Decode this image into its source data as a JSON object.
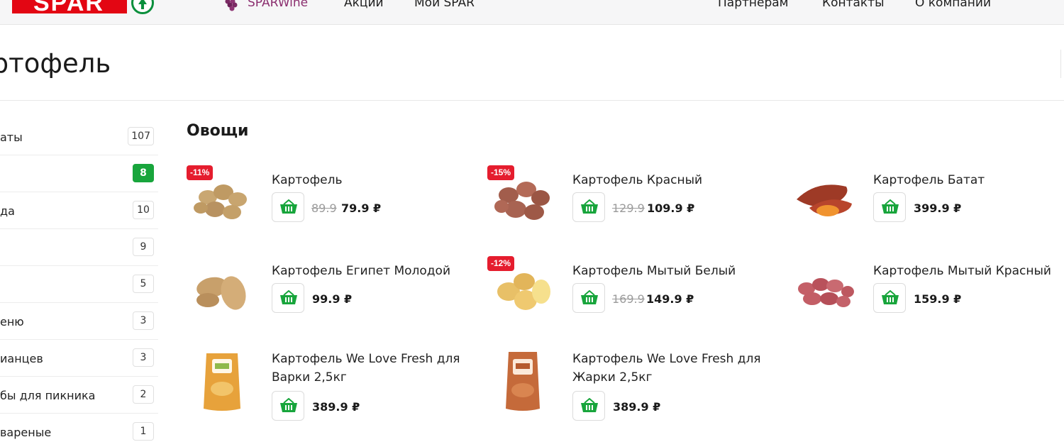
{
  "header": {
    "logo_text": "SPAR",
    "nav_left": [
      {
        "label": "SPARWine"
      },
      {
        "label": "Акции"
      },
      {
        "label": "Мой SPAR"
      }
    ],
    "nav_right": [
      {
        "label": "Партнерам"
      },
      {
        "label": "Контакты"
      },
      {
        "label": "О компании"
      }
    ]
  },
  "page": {
    "title": "артофель"
  },
  "sidebar": {
    "items": [
      {
        "label": "аты",
        "count": "107",
        "active": false
      },
      {
        "label": "",
        "count": "8",
        "active": true
      },
      {
        "label": "да",
        "count": "10",
        "active": false
      },
      {
        "label": "",
        "count": "9",
        "active": false
      },
      {
        "label": "",
        "count": "5",
        "active": false
      },
      {
        "label": "еню",
        "count": "3",
        "active": false
      },
      {
        "label": "ианцев",
        "count": "3",
        "active": false
      },
      {
        "label": "бы для пикника",
        "count": "2",
        "active": false
      },
      {
        "label": " вареные",
        "count": "1",
        "active": false
      }
    ]
  },
  "section": {
    "title": "Овощи"
  },
  "products": [
    {
      "name": "Картофель",
      "badge": "-11%",
      "old_price": "89.9",
      "price": "79.9 ₽",
      "image": "potato-brown"
    },
    {
      "name": "Картофель Красный",
      "badge": "-15%",
      "old_price": "129.9",
      "price": "109.9 ₽",
      "image": "potato-red"
    },
    {
      "name": "Картофель Батат",
      "badge": "",
      "old_price": "",
      "price": "399.9 ₽",
      "image": "sweet-potato"
    },
    {
      "name": "Картофель Египет Молодой",
      "badge": "",
      "old_price": "",
      "price": "99.9 ₽",
      "image": "potato-large"
    },
    {
      "name": "Картофель Мытый Белый",
      "badge": "-12%",
      "old_price": "169.9",
      "price": "149.9 ₽",
      "image": "potato-yellow"
    },
    {
      "name": "Картофель Мытый Красный",
      "badge": "",
      "old_price": "",
      "price": "159.9 ₽",
      "image": "potato-pink"
    },
    {
      "name": "Картофель We Love Fresh для Варки 2,5кг",
      "badge": "",
      "old_price": "",
      "price": "389.9 ₽",
      "image": "bag-boil"
    },
    {
      "name": "Картофель We Love Fresh для Жарки 2,5кг",
      "badge": "",
      "old_price": "",
      "price": "389.9 ₽",
      "image": "bag-fry"
    }
  ],
  "colors": {
    "brand_red": "#e30613",
    "accent_green": "#18a53c",
    "badge_red": "#e51d2e",
    "wine_purple": "#8b2f6f"
  }
}
